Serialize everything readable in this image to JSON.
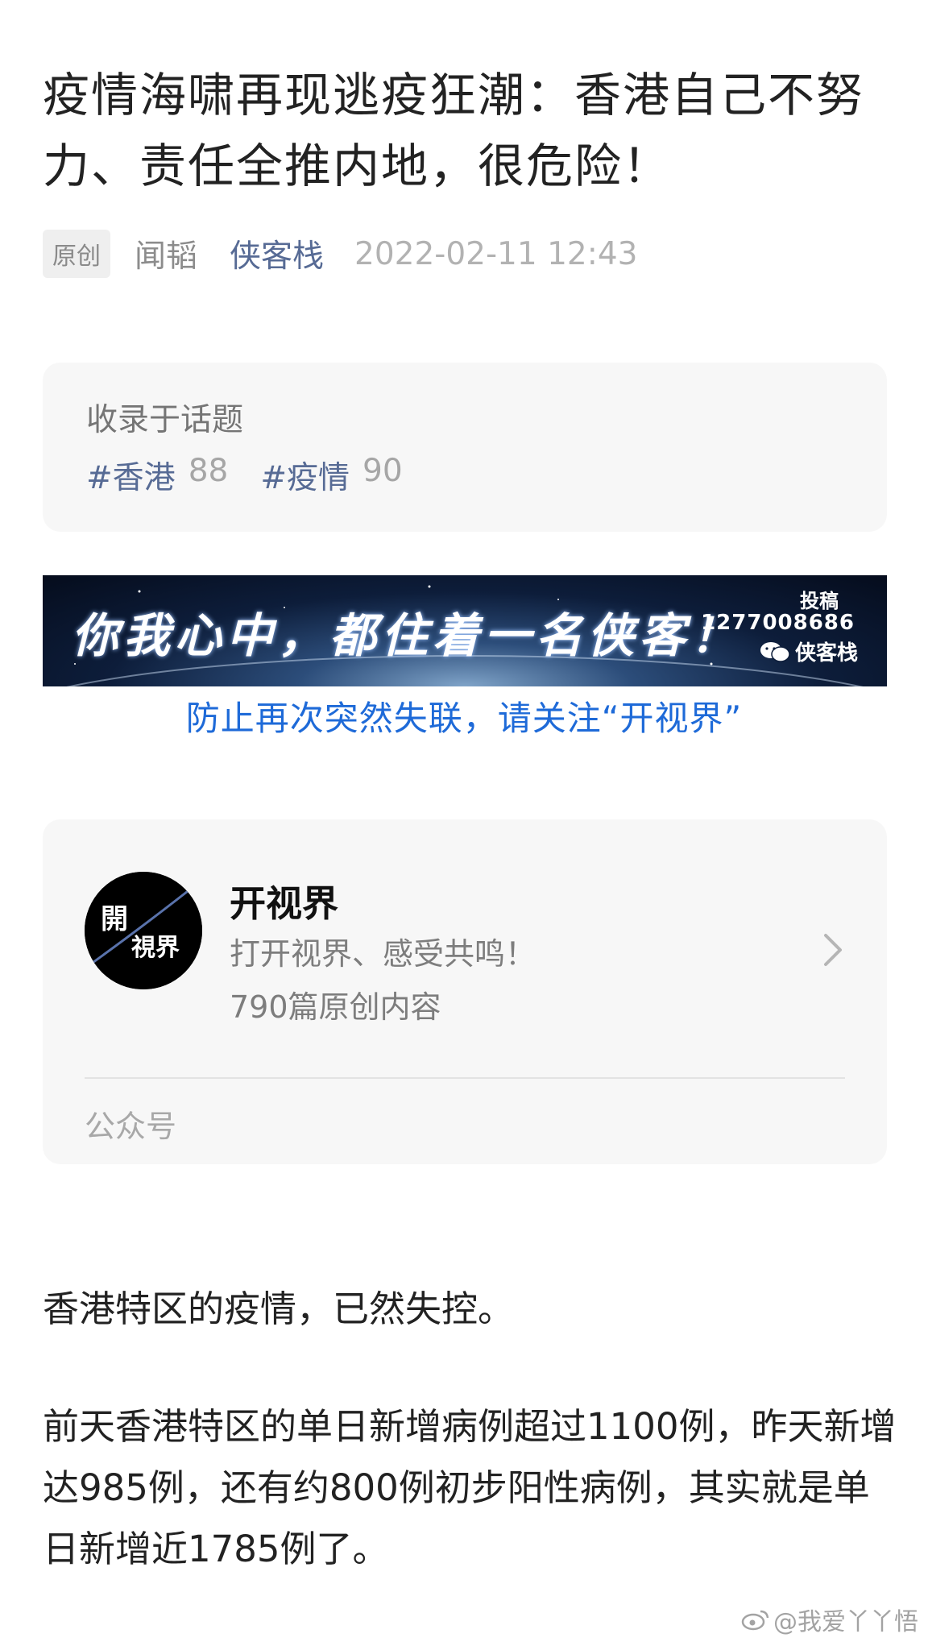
{
  "article": {
    "title": "疫情海啸再现逃疫狂潮：香港自己不努力、责任全推内地，很危险！",
    "badge": "原创",
    "author": "闻韬",
    "account": "侠客栈",
    "publish_time": "2022-02-11 12:43"
  },
  "topics": {
    "heading": "收录于话题",
    "items": [
      {
        "name": "#香港",
        "count": "88"
      },
      {
        "name": "#疫情",
        "count": "90"
      }
    ]
  },
  "banner": {
    "slogan": "你我心中，都住着一名侠客！",
    "submit_label": "投稿",
    "phone": "1277008686",
    "brand": "侠客栈"
  },
  "follow_notice": "防止再次突然失联，请关注“开视界”",
  "account_card": {
    "avatar_text_1": "開",
    "avatar_text_2": "視界",
    "name": "开视界",
    "slogan": "打开视界、感受共鸣！",
    "articles": "790篇原创内容",
    "type": "公众号"
  },
  "body": {
    "paragraphs": [
      "香港特区的疫情，已然失控。",
      "前天香港特区的单日新增病例超过1100例，昨天新增达985例，还有约800例初步阳性病例，其实就是单日新增近1785例了。"
    ]
  },
  "watermark": "@我爱丫丫悟",
  "colors": {
    "link": "#576b95",
    "notice": "#1e6ad8",
    "card_bg": "#f7f7f7"
  }
}
